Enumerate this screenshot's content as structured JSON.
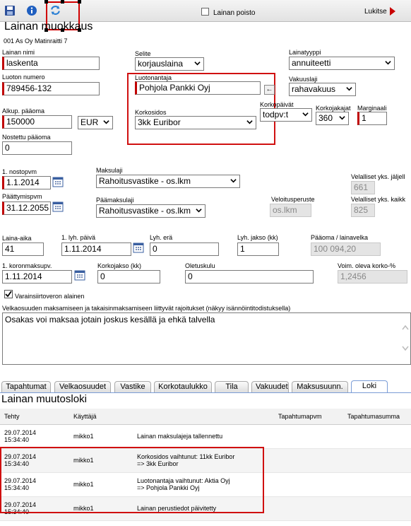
{
  "toolbar": {
    "save_icon": "save-icon",
    "info_icon": "info-icon",
    "refresh_icon": "refresh-icon",
    "lainan_poisto_label": "Lainan poisto",
    "lukitse_label": "Lukitse"
  },
  "page": {
    "title": "Lainan muokkaus",
    "subtitle": "001 As Oy Matinraitti 7"
  },
  "form": {
    "lainan_nimi": {
      "label": "Lainan nimi",
      "value": "laskenta"
    },
    "selite": {
      "label": "Selite",
      "value": "korjauslaina"
    },
    "lainatyyppi": {
      "label": "Lainatyyppi",
      "value": "annuiteetti"
    },
    "luoton_numero": {
      "label": "Luoton numero",
      "value": "789456-132"
    },
    "luotonantaja": {
      "label": "Luotonantaja",
      "value": "Pohjola Pankki Oyj",
      "button": "←"
    },
    "vakuuslaji": {
      "label": "Vakuuslaji",
      "value": "rahavakuus"
    },
    "alkup_paaoma": {
      "label": "Alkup. pääoma",
      "value": "150000",
      "currency": "EUR"
    },
    "korkosidos": {
      "label": "Korkosidos",
      "value": "3kk Euribor"
    },
    "korkopaivat": {
      "label": "Korkopäivät",
      "value": "todpv:t"
    },
    "korkojakajat": {
      "label": "Korkojakajat",
      "value": "360"
    },
    "marginaali": {
      "label": "Marginaali",
      "value": "1"
    },
    "nostettu_paaoma": {
      "label": "Nostettu pääoma",
      "value": "0"
    },
    "nostopvm": {
      "label": "1. nostopvm",
      "value": "1.1.2014"
    },
    "maksulaji": {
      "label": "Maksulaji",
      "value": "Rahoitusvastike - os.lkm"
    },
    "velalliset_jaljella": {
      "label": "Velalliset yks. jäljell",
      "value": "661"
    },
    "paattymispvm": {
      "label": "Päättymispvm",
      "value": "31.12.2055"
    },
    "paamaksulaji": {
      "label": "Päämaksulaji",
      "value": "Rahoitusvastike - os.lkm"
    },
    "veloitusperuste": {
      "label": "Veloitusperuste",
      "value": "os.lkm"
    },
    "velalliset_kaikki": {
      "label": "Velalliset yks. kaikk",
      "value": "825"
    },
    "laina_aika": {
      "label": "Laina-aika",
      "value": "41"
    },
    "lyh_paiva": {
      "label": "1. lyh. päivä",
      "value": "1.11.2014"
    },
    "lyh_era": {
      "label": "Lyh. erä",
      "value": "0"
    },
    "lyh_jakso": {
      "label": "Lyh. jakso (kk)",
      "value": "1"
    },
    "paaoma_lainavelka": {
      "label": "Pääoma / lainavelka",
      "value": "100 094,20"
    },
    "koronmaksupv": {
      "label": "1. koronmaksupv.",
      "value": "1.11.2014"
    },
    "korkojakso": {
      "label": "Korkojakso (kk)",
      "value": "0"
    },
    "oletuskulu": {
      "label": "Oletuskulu",
      "value": "0"
    },
    "voim_korko": {
      "label": "Voim. oleva korko-%",
      "value": "1,2456"
    },
    "varainsiirtovero": {
      "label": "Varainsiirtoveron alainen",
      "checked": true
    },
    "rajoitukset": {
      "label": "Velkaosuuden maksamiseen ja takaisinmaksamiseen liittyvät rajoitukset (näkyy isännöintitodistuksella)",
      "value": "Osakas voi maksaa jotain joskus kesällä ja ehkä talvella"
    }
  },
  "tabs": [
    "Tapahtumat",
    "Velkaosuudet",
    "Vastike",
    "Korkotaulukko",
    "Tila",
    "Vakuudet",
    "Maksusuunn.",
    "Loki"
  ],
  "log": {
    "title": "Lainan muutosloki",
    "headers": [
      "Tehty",
      "Käyttäjä",
      "",
      "Tapahtumapvm",
      "Tapahtumasumma"
    ],
    "rows": [
      {
        "date": "29.07.2014",
        "time": "15:34:40",
        "user": "mikko1",
        "line1": "Lainan maksulajeja tallennettu",
        "line2": ""
      },
      {
        "date": "29.07.2014",
        "time": "15:34:40",
        "user": "mikko1",
        "line1": "Korkosidos vaihtunut: 11kk Euribor",
        "line2": "=> 3kk Euribor"
      },
      {
        "date": "29.07.2014",
        "time": "15:34:40",
        "user": "mikko1",
        "line1": "Luotonantaja vaihtunut: Aktia Oyj",
        "line2": "=> Pohjola Pankki Oyj"
      },
      {
        "date": "29.07.2014",
        "time": "15:34:40",
        "user": "mikko1",
        "line1": "Lainan perustiedot päivitetty",
        "line2": ""
      }
    ]
  },
  "colors": {
    "highlight": "#d01010",
    "required": "#c00000",
    "readonly": "#e4e4e4"
  }
}
